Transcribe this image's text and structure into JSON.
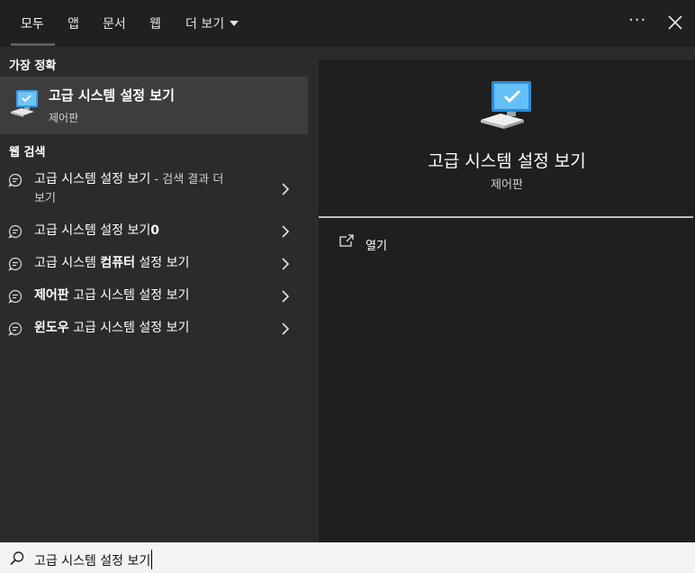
{
  "tabs": [
    {
      "label": "모두"
    },
    {
      "label": "앱"
    },
    {
      "label": "문서"
    },
    {
      "label": "웹"
    },
    {
      "label": "더 보기"
    }
  ],
  "more_dots": "···",
  "best_match": {
    "header": "가장 정확",
    "title": "고급 시스템 설정 보기",
    "subtitle": "제어판"
  },
  "web": {
    "header": "웹 검색",
    "r1": {
      "main": "고급 시스템 설정 보기",
      "suffix": " - 검색 결과 더",
      "line2": "보기"
    },
    "r2": {
      "main": "고급 시스템 설정 보기",
      "bold": "0"
    },
    "r3": {
      "main": "고급 시스템 ",
      "bold": "컴퓨터",
      "rest": " 설정 보기"
    },
    "r4": {
      "bold": "제어판",
      "rest": " 고급 시스템 설정 보기"
    },
    "r5": {
      "bold": "윈도우",
      "rest": " 고급 시스템 설정 보기"
    }
  },
  "preview": {
    "title": "고급 시스템 설정 보기",
    "subtitle": "제어판",
    "open_label": "열기"
  },
  "search": {
    "value": "고급 시스템 설정 보기"
  },
  "colors": {
    "panel": "#2b2b2b",
    "preview": "#1f1f1f",
    "selected": "#3d3d3d",
    "accent": "#4cc2ff"
  }
}
